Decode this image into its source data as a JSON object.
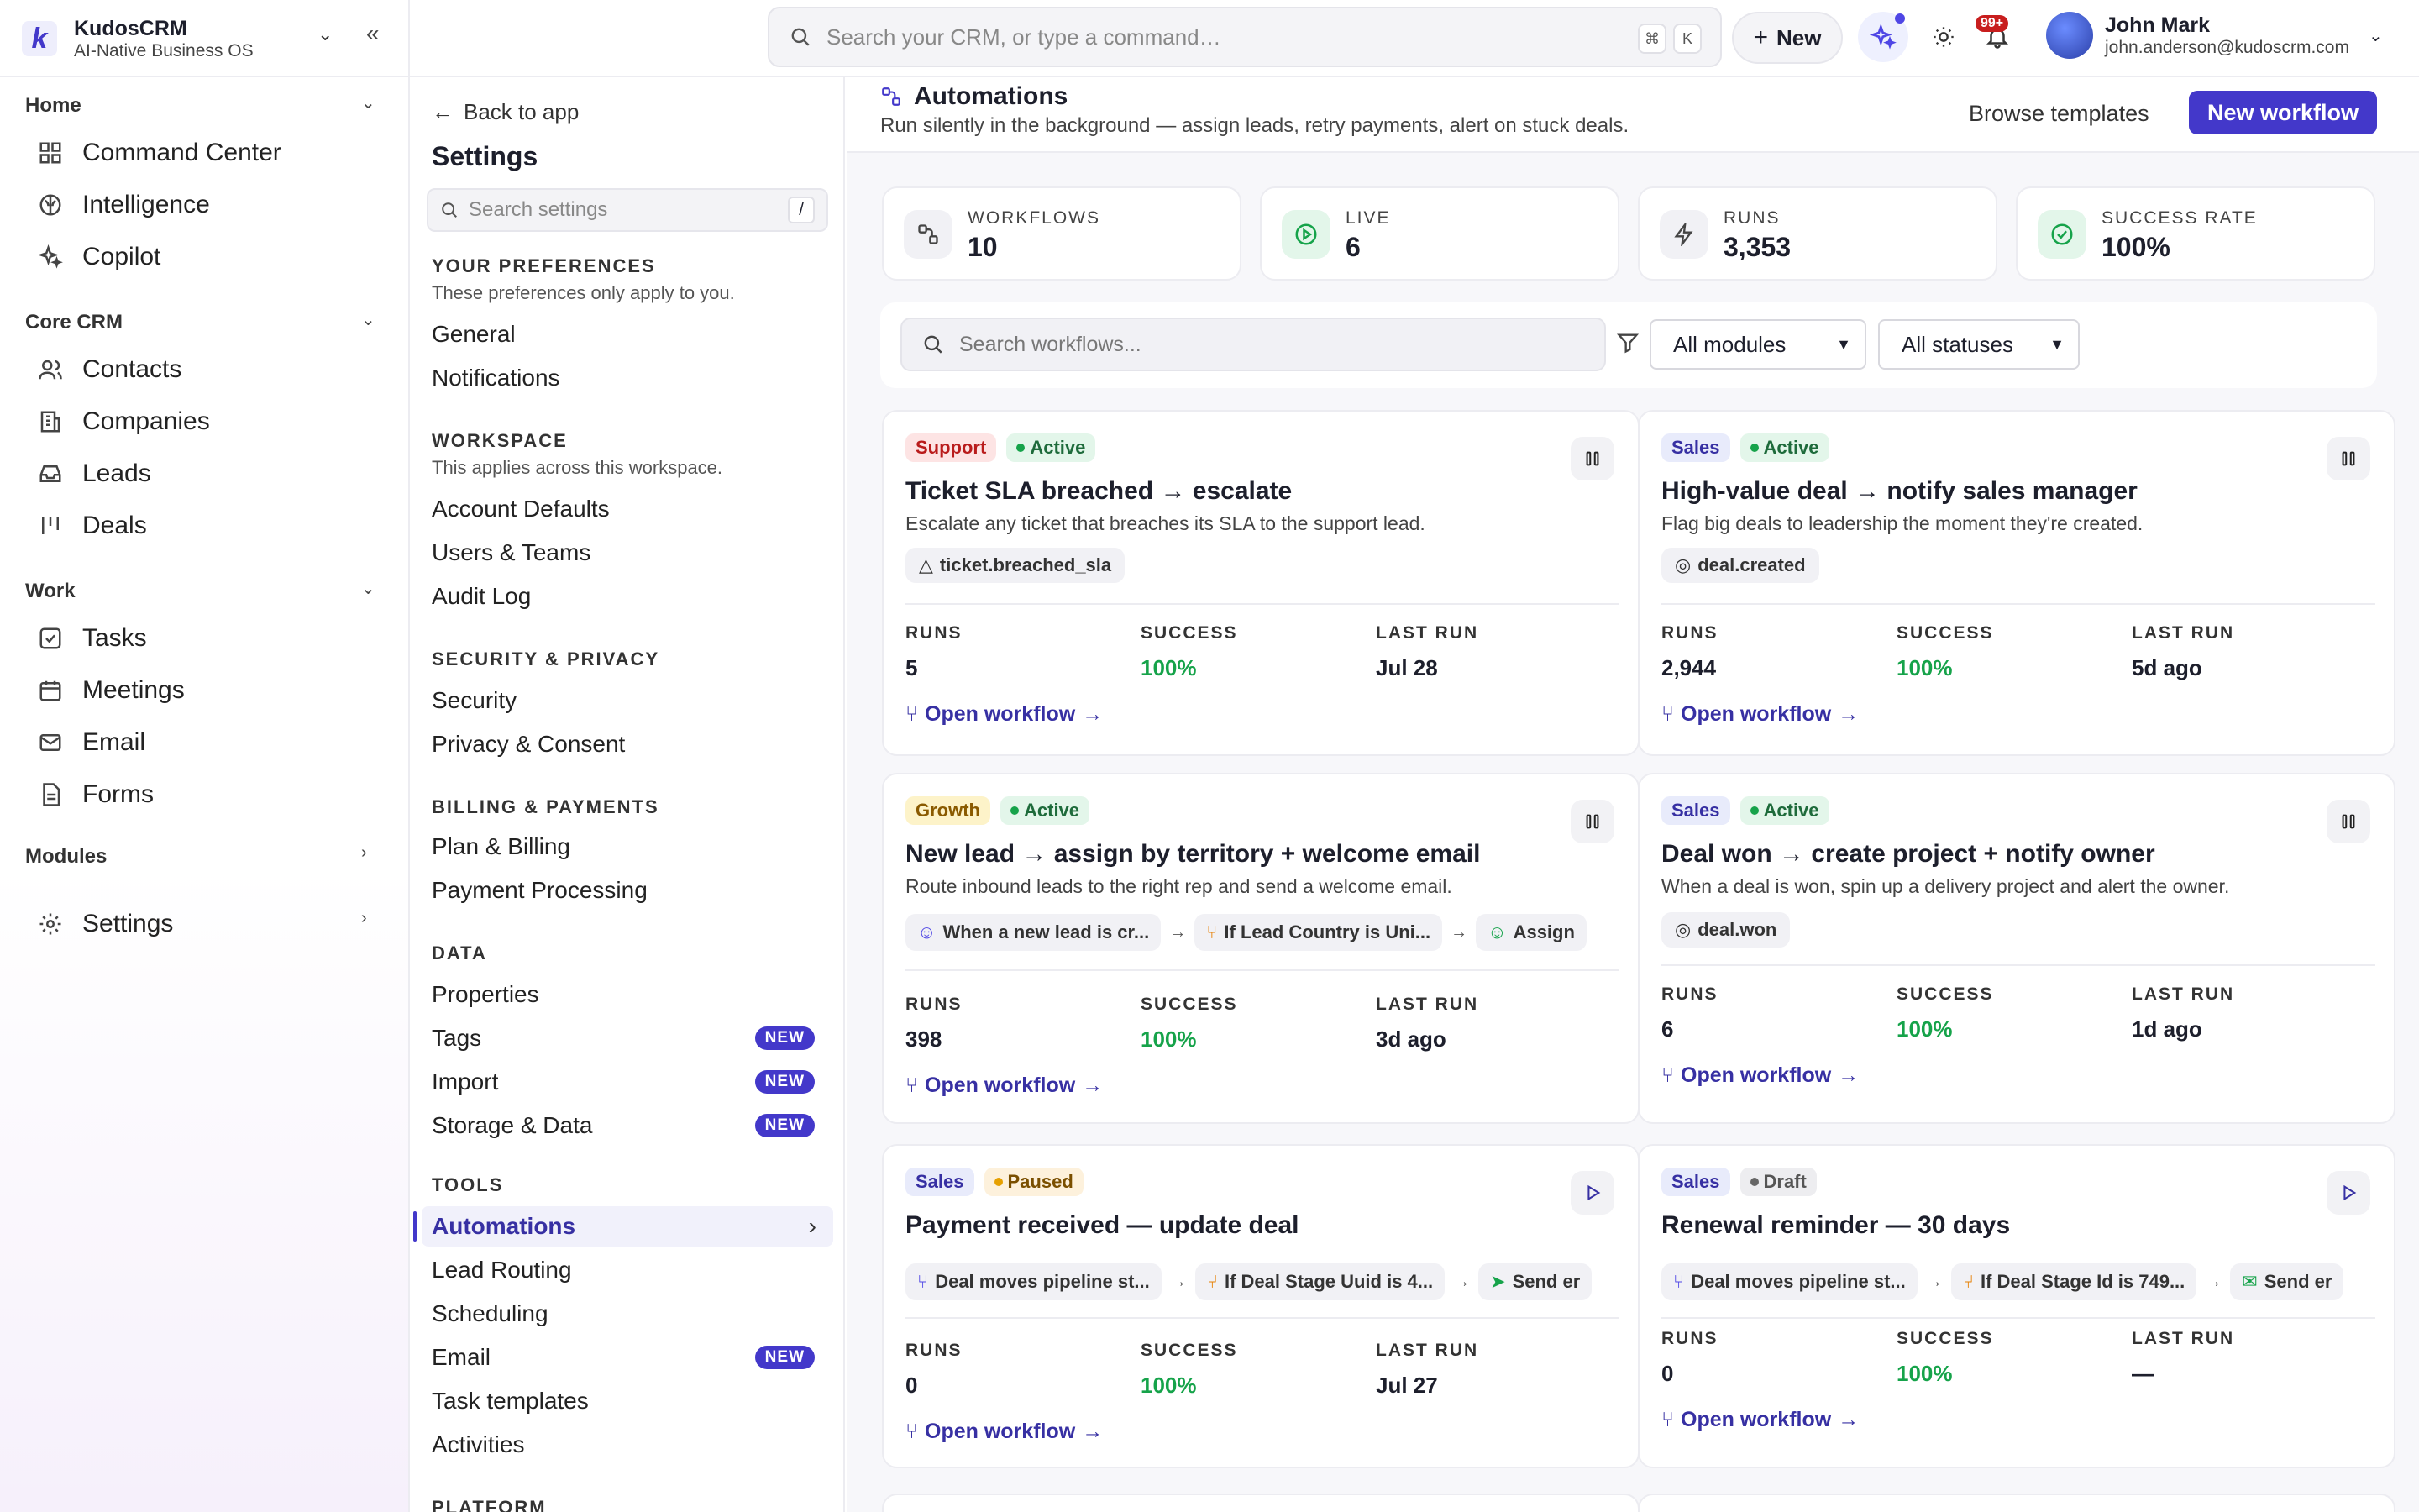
{
  "brand": {
    "name": "KudosCRM",
    "subtitle": "AI-Native Business OS",
    "logo_letter": "k"
  },
  "topbar": {
    "search_placeholder": "Search your CRM, or type a command…",
    "kbd_cmd": "⌘",
    "kbd_k": "K",
    "new_label": "New",
    "notif_badge": "99+",
    "user": {
      "name": "John Mark",
      "email": "john.anderson@kudoscrm.com"
    }
  },
  "sidebar": {
    "home": {
      "label": "Home",
      "items": [
        "Command Center",
        "Intelligence",
        "Copilot"
      ]
    },
    "core": {
      "label": "Core CRM",
      "items": [
        "Contacts",
        "Companies",
        "Leads",
        "Deals"
      ]
    },
    "work": {
      "label": "Work",
      "items": [
        "Tasks",
        "Meetings",
        "Email",
        "Forms"
      ]
    },
    "modules": {
      "label": "Modules"
    },
    "settings": {
      "label": "Settings"
    }
  },
  "settings_nav": {
    "back": "Back to app",
    "title": "Settings",
    "search_placeholder": "Search settings",
    "search_key": "/",
    "new_tag": "NEW",
    "groups": {
      "prefs": {
        "label": "YOUR PREFERENCES",
        "sub": "These preferences only apply to you.",
        "items": [
          "General",
          "Notifications"
        ]
      },
      "workspace": {
        "label": "WORKSPACE",
        "sub": "This applies across this workspace.",
        "items": [
          "Account Defaults",
          "Users & Teams",
          "Audit Log"
        ]
      },
      "security": {
        "label": "SECURITY & PRIVACY",
        "items": [
          "Security",
          "Privacy & Consent"
        ]
      },
      "billing": {
        "label": "BILLING & PAYMENTS",
        "items": [
          "Plan & Billing",
          "Payment Processing"
        ]
      },
      "data": {
        "label": "DATA",
        "items": [
          "Properties",
          "Tags",
          "Import",
          "Storage & Data"
        ]
      },
      "tools": {
        "label": "TOOLS",
        "items": [
          "Automations",
          "Lead Routing",
          "Scheduling",
          "Email",
          "Task templates",
          "Activities"
        ]
      },
      "platform": {
        "label": "PLATFORM"
      }
    }
  },
  "main": {
    "title": "Automations",
    "subtitle": "Run silently in the background — assign leads, retry payments, alert on stuck deals.",
    "browse": "Browse templates",
    "new_workflow": "New workflow",
    "stats": [
      {
        "label": "WORKFLOWS",
        "value": "10"
      },
      {
        "label": "LIVE",
        "value": "6"
      },
      {
        "label": "RUNS",
        "value": "3,353"
      },
      {
        "label": "SUCCESS RATE",
        "value": "100%"
      }
    ],
    "filter": {
      "search_placeholder": "Search workflows...",
      "module": "All modules",
      "status": "All statuses"
    },
    "metric_labels": {
      "runs": "RUNS",
      "success": "SUCCESS",
      "last_run": "LAST RUN"
    },
    "open_label": "Open workflow",
    "cards": [
      {
        "module": "Support",
        "status": "Active",
        "title": "Ticket SLA breached → escalate",
        "desc": "Escalate any ticket that breaches its SLA to the support lead.",
        "trigger": "ticket.breached_sla",
        "runs": "5",
        "success": "100%",
        "last_run": "Jul 28"
      },
      {
        "module": "Sales",
        "status": "Active",
        "title": "High-value deal → notify sales manager",
        "desc": "Flag big deals to leadership the moment they're created.",
        "trigger": "deal.created",
        "runs": "2,944",
        "success": "100%",
        "last_run": "5d ago"
      },
      {
        "module": "Growth",
        "status": "Active",
        "title": "New lead → assign by territory + welcome email",
        "desc": "Route inbound leads to the right rep and send a welcome email.",
        "steps": [
          "When a new lead is cr...",
          "If Lead Country is Uni...",
          "Assign"
        ],
        "runs": "398",
        "success": "100%",
        "last_run": "3d ago"
      },
      {
        "module": "Sales",
        "status": "Active",
        "title": "Deal won → create project + notify owner",
        "desc": "When a deal is won, spin up a delivery project and alert the owner.",
        "trigger": "deal.won",
        "runs": "6",
        "success": "100%",
        "last_run": "1d ago"
      },
      {
        "module": "Sales",
        "status": "Paused",
        "title": "Payment received — update deal",
        "steps": [
          "Deal moves pipeline st...",
          "If Deal Stage Uuid is 4...",
          "Send er"
        ],
        "runs": "0",
        "success": "100%",
        "last_run": "Jul 27"
      },
      {
        "module": "Sales",
        "status": "Draft",
        "title": "Renewal reminder — 30 days",
        "steps": [
          "Deal moves pipeline st...",
          "If Deal Stage Id is 749...",
          "Send er"
        ],
        "runs": "0",
        "success": "100%",
        "last_run": "—"
      }
    ]
  },
  "colors": {
    "accent": "#4338ca",
    "success": "#16a34a",
    "danger": "#c81e1e"
  }
}
